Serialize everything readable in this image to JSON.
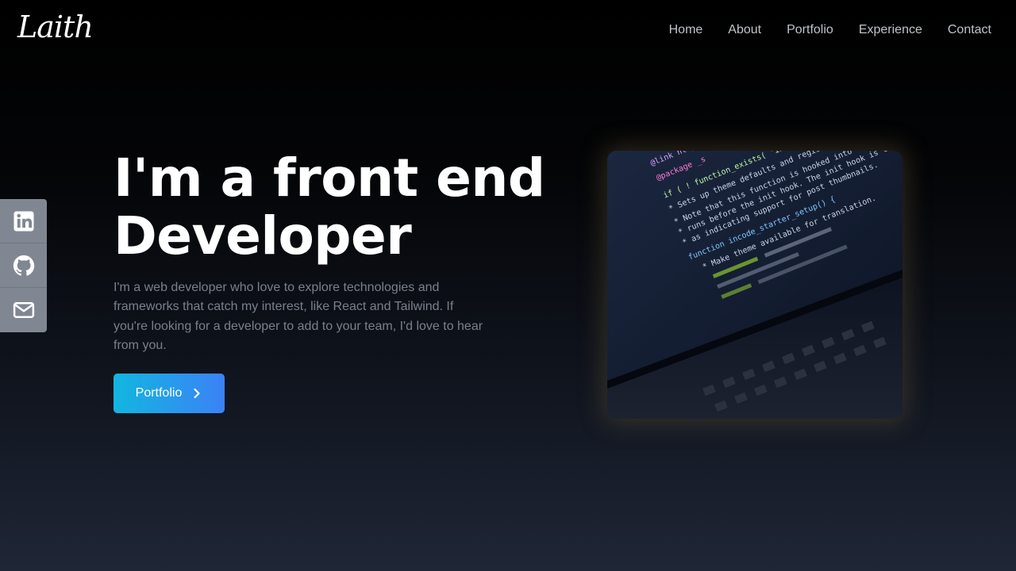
{
  "header": {
    "logo": "Laith",
    "nav": [
      "Home",
      "About",
      "Portfolio",
      "Experience",
      "Contact"
    ]
  },
  "social": [
    {
      "icon": "linkedin-icon"
    },
    {
      "icon": "github-icon"
    },
    {
      "icon": "mail-icon"
    }
  ],
  "hero": {
    "title_line1": "I'm a front end",
    "title_line2": "Developer",
    "description": "I'm a web developer who love to explore technologies and frameworks that catch my interest, like React and Tailwind. If you're looking for a developer to add to your team, I'd love to hear from you.",
    "button_label": "Portfolio",
    "button_icon": "chevron-right-icon"
  },
  "image_code": [
    "@link https://deve",
    "@package _s",
    "if ( ! function_exists( 'incode_starter_setup' ) ) :",
    "* Sets up theme defaults and registers support for various WordPress",
    "* Note that this function is hooked into the after_setup_theme hook, which",
    "* runs before the init hook. The init hook is too late for some features, such",
    "* as indicating support for post thumbnails.",
    "function incode_starter_setup() {",
    "* Make theme available for translation."
  ],
  "colors": {
    "accent_start": "#12b6e0",
    "accent_end": "#3b82f6",
    "sidebar": "#808792"
  }
}
